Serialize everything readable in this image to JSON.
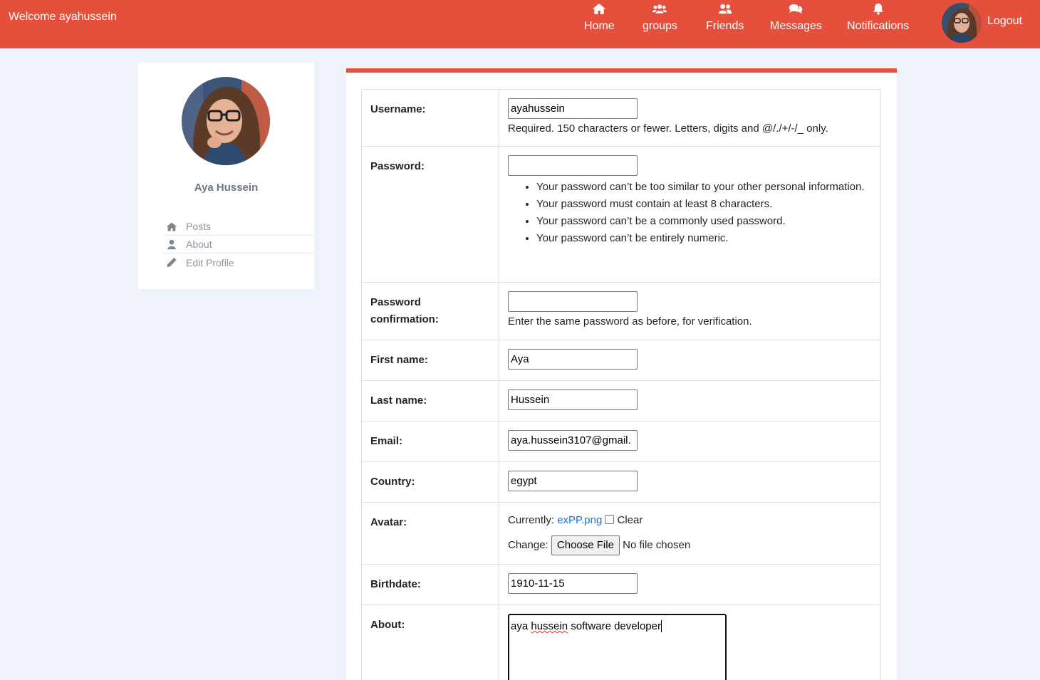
{
  "navbar": {
    "welcome": "Welcome ayahussein",
    "items": [
      {
        "label": "Home",
        "icon": "home-icon"
      },
      {
        "label": "groups",
        "icon": "users-icon"
      },
      {
        "label": "Friends",
        "icon": "user-friends-icon"
      },
      {
        "label": "Messages",
        "icon": "comments-icon"
      },
      {
        "label": "Notifications",
        "icon": "bell-icon"
      }
    ],
    "logout": "Logout"
  },
  "sidebar": {
    "name": "Aya Hussein",
    "links": [
      {
        "label": "Posts",
        "icon": "home-icon"
      },
      {
        "label": "About",
        "icon": "user-icon"
      },
      {
        "label": "Edit Profile",
        "icon": "pencil-icon"
      }
    ]
  },
  "form": {
    "username": {
      "label": "Username:",
      "value": "ayahussein",
      "help": "Required. 150 characters or fewer. Letters, digits and @/./+/-/_ only."
    },
    "password": {
      "label": "Password:",
      "value": "",
      "rules": [
        "Your password can’t be too similar to your other personal information.",
        "Your password must contain at least 8 characters.",
        "Your password can’t be a commonly used password.",
        "Your password can’t be entirely numeric."
      ]
    },
    "password_confirmation": {
      "label_line1": "Password",
      "label_line2": "confirmation:",
      "value": "",
      "help": "Enter the same password as before, for verification."
    },
    "first_name": {
      "label": "First name:",
      "value": "Aya"
    },
    "last_name": {
      "label": "Last name:",
      "value": "Hussein"
    },
    "email": {
      "label": "Email:",
      "value": "aya.hussein3107@gmail."
    },
    "country": {
      "label": "Country:",
      "value": "egypt"
    },
    "avatar": {
      "label": "Avatar:",
      "currently": "Currently:",
      "file": "exPP.png",
      "clear": "Clear",
      "change": "Change:",
      "choose": "Choose File",
      "no_file": "No file chosen"
    },
    "birthdate": {
      "label": "Birthdate:",
      "value": "1910-11-15"
    },
    "about": {
      "label": "About:",
      "value_before": "aya ",
      "value_misspelled": "hussein",
      "value_after": " software developer"
    }
  },
  "colors": {
    "brand": "#e64f3b",
    "background": "#eef3fb",
    "link": "#1a73e8"
  }
}
